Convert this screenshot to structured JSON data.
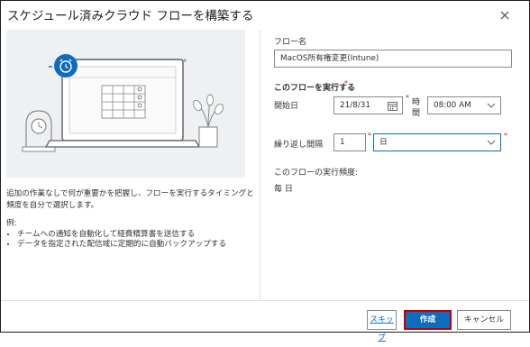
{
  "dialog": {
    "title": "スケジュール済みクラウド フローを構築する",
    "close_icon": "close-icon"
  },
  "description": {
    "text": "追加の作業なしで何が重要かを把握し、フローを実行するタイミングと頻度を自分で選択します。",
    "examples_heading": "例:",
    "examples": [
      "チームへの通知を自動化して経費精算書を送信する",
      "データを指定された配信域に定期的に自動バックアップする"
    ]
  },
  "form": {
    "flow_name_label": "フロー名",
    "flow_name_value": "MacOS所有権変更(Intune)",
    "run_label": "このフローを実行する",
    "start_label": "開始日",
    "start_date": "21/8/31",
    "time_label": "時間",
    "time_value": "08:00 AM",
    "repeat_label": "繰り返し間隔",
    "repeat_count": "1",
    "repeat_unit": "日",
    "frequency_label": "このフローの実行頻度:",
    "frequency_value": "毎 日"
  },
  "footer": {
    "skip_label": "スキップ",
    "create_label": "作成",
    "cancel_label": "キャンセル"
  },
  "colors": {
    "accent": "#0f6cbd",
    "highlight_border": "#c00000",
    "required": "#a4262c",
    "illustration_bg": "#eef1f4"
  }
}
